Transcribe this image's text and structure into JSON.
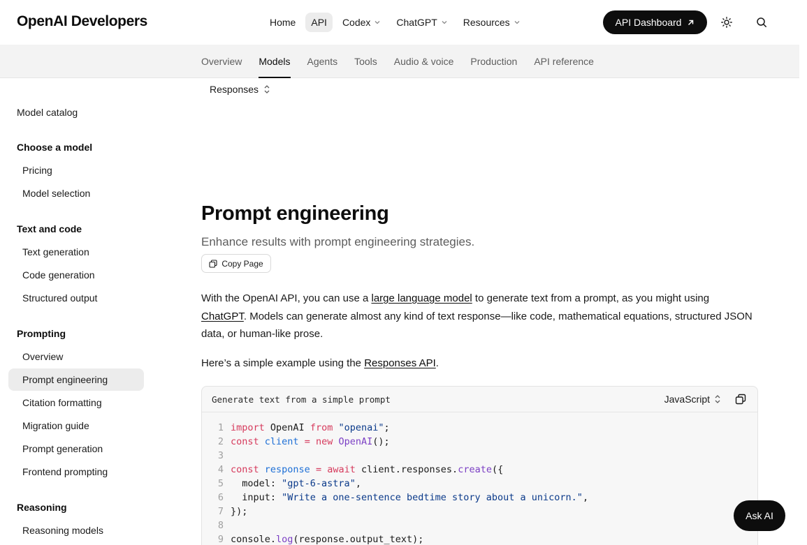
{
  "header": {
    "logo": "OpenAI Developers",
    "nav": [
      {
        "label": "Home",
        "dropdown": false
      },
      {
        "label": "API",
        "dropdown": false,
        "active": true
      },
      {
        "label": "Codex",
        "dropdown": true
      },
      {
        "label": "ChatGPT",
        "dropdown": true
      },
      {
        "label": "Resources",
        "dropdown": true
      }
    ],
    "dashboard_label": "API Dashboard",
    "icons": [
      "sun-icon",
      "search-icon"
    ]
  },
  "subnav": {
    "tabs": [
      "Overview",
      "Models",
      "Agents",
      "Tools",
      "Audio & voice",
      "Production",
      "API reference"
    ],
    "active": "Models"
  },
  "sidebar": {
    "top_link": "Model catalog",
    "sections": [
      {
        "heading": "Choose a model",
        "items": [
          "Pricing",
          "Model selection"
        ]
      },
      {
        "heading": "Text and code",
        "items": [
          "Text generation",
          "Code generation",
          "Structured output"
        ]
      },
      {
        "heading": "Prompting",
        "items": [
          "Overview",
          "Prompt engineering",
          "Citation formatting",
          "Migration guide",
          "Prompt generation",
          "Frontend prompting"
        ]
      },
      {
        "heading": "Reasoning",
        "items": [
          "Reasoning models"
        ]
      }
    ],
    "active_item": "Prompt engineering"
  },
  "content": {
    "api_select": "Responses",
    "title": "Prompt engineering",
    "subtitle": "Enhance results with prompt engineering strategies.",
    "copy_page_label": "Copy Page",
    "para1": {
      "t1": "With the OpenAI API, you can use a ",
      "link1": "large language model",
      "t2": " to generate text from a prompt, as you might using ",
      "link2": "ChatGPT",
      "t3": ". Models can generate almost any kind of text response—like code, mathematical equations, structured JSON data, or human-like prose."
    },
    "para2": {
      "t1": "Here’s a simple example using the ",
      "link": "Responses API",
      "t2": "."
    },
    "code": {
      "title": "Generate text from a simple prompt",
      "language": "JavaScript",
      "lines": [
        {
          "n": "1",
          "tokens": [
            [
              "kw",
              "import"
            ],
            [
              "cl",
              " OpenAI "
            ],
            [
              "kw",
              "from"
            ],
            [
              "cl",
              " "
            ],
            [
              "str",
              "\"openai\""
            ],
            [
              "cl",
              ";"
            ]
          ]
        },
        {
          "n": "2",
          "tokens": [
            [
              "kw",
              "const"
            ],
            [
              "cl",
              " "
            ],
            [
              "var",
              "client"
            ],
            [
              "cl",
              " "
            ],
            [
              "kw",
              "="
            ],
            [
              "cl",
              " "
            ],
            [
              "kw",
              "new"
            ],
            [
              "cl",
              " "
            ],
            [
              "fn",
              "OpenAI"
            ],
            [
              "cl",
              "();"
            ]
          ]
        },
        {
          "n": "3",
          "tokens": []
        },
        {
          "n": "4",
          "tokens": [
            [
              "kw",
              "const"
            ],
            [
              "cl",
              " "
            ],
            [
              "var",
              "response"
            ],
            [
              "cl",
              " "
            ],
            [
              "kw",
              "="
            ],
            [
              "cl",
              " "
            ],
            [
              "kw",
              "await"
            ],
            [
              "cl",
              " client.responses."
            ],
            [
              "fn",
              "create"
            ],
            [
              "cl",
              "({"
            ]
          ]
        },
        {
          "n": "5",
          "tokens": [
            [
              "cl",
              "  model: "
            ],
            [
              "str",
              "\"gpt-6-astra\""
            ],
            [
              "cl",
              ","
            ]
          ]
        },
        {
          "n": "6",
          "tokens": [
            [
              "cl",
              "  input: "
            ],
            [
              "str",
              "\"Write a one-sentence bedtime story about a unicorn.\""
            ],
            [
              "cl",
              ","
            ]
          ]
        },
        {
          "n": "7",
          "tokens": [
            [
              "cl",
              "});"
            ]
          ]
        },
        {
          "n": "8",
          "tokens": []
        },
        {
          "n": "9",
          "tokens": [
            [
              "cl",
              "console."
            ],
            [
              "fn",
              "log"
            ],
            [
              "cl",
              "(response.output_text);"
            ]
          ]
        }
      ]
    }
  },
  "ask_ai_label": "Ask AI"
}
